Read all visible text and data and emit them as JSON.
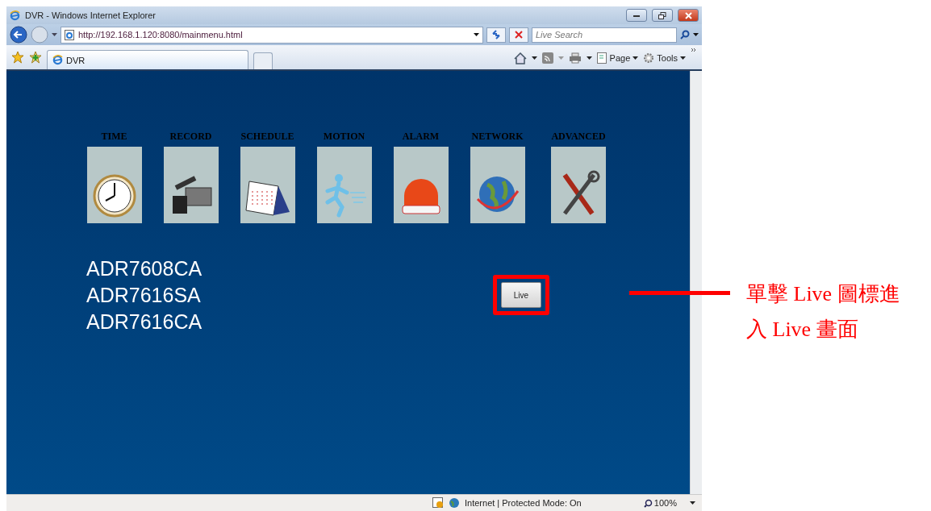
{
  "window": {
    "title": "DVR - Windows Internet Explorer"
  },
  "address_bar": {
    "url": "http://192.168.1.120:8080/mainmenu.html"
  },
  "search": {
    "placeholder": "Live Search"
  },
  "tabs": [
    {
      "label": "DVR",
      "selected": true
    }
  ],
  "command_bar": [
    "Page",
    "Tools"
  ],
  "menu": [
    {
      "label": "TIME",
      "kind": "clock"
    },
    {
      "label": "RECORD",
      "kind": "camera"
    },
    {
      "label": "SCHEDULE",
      "kind": "calendar"
    },
    {
      "label": "MOTION",
      "kind": "runner"
    },
    {
      "label": "ALARM",
      "kind": "alarm"
    },
    {
      "label": "NETWORK",
      "kind": "globe"
    },
    {
      "label": "ADVANCED",
      "kind": "tools"
    }
  ],
  "models": [
    "ADR7608CA",
    "ADR7616SA",
    "ADR7616CA"
  ],
  "live_button": "Live",
  "status_bar": {
    "zone": "Internet | Protected Mode: On",
    "zoom": "100%"
  },
  "annotation": {
    "lines": [
      "單擊 Live 圖標進",
      "入 Live 畫面"
    ]
  }
}
